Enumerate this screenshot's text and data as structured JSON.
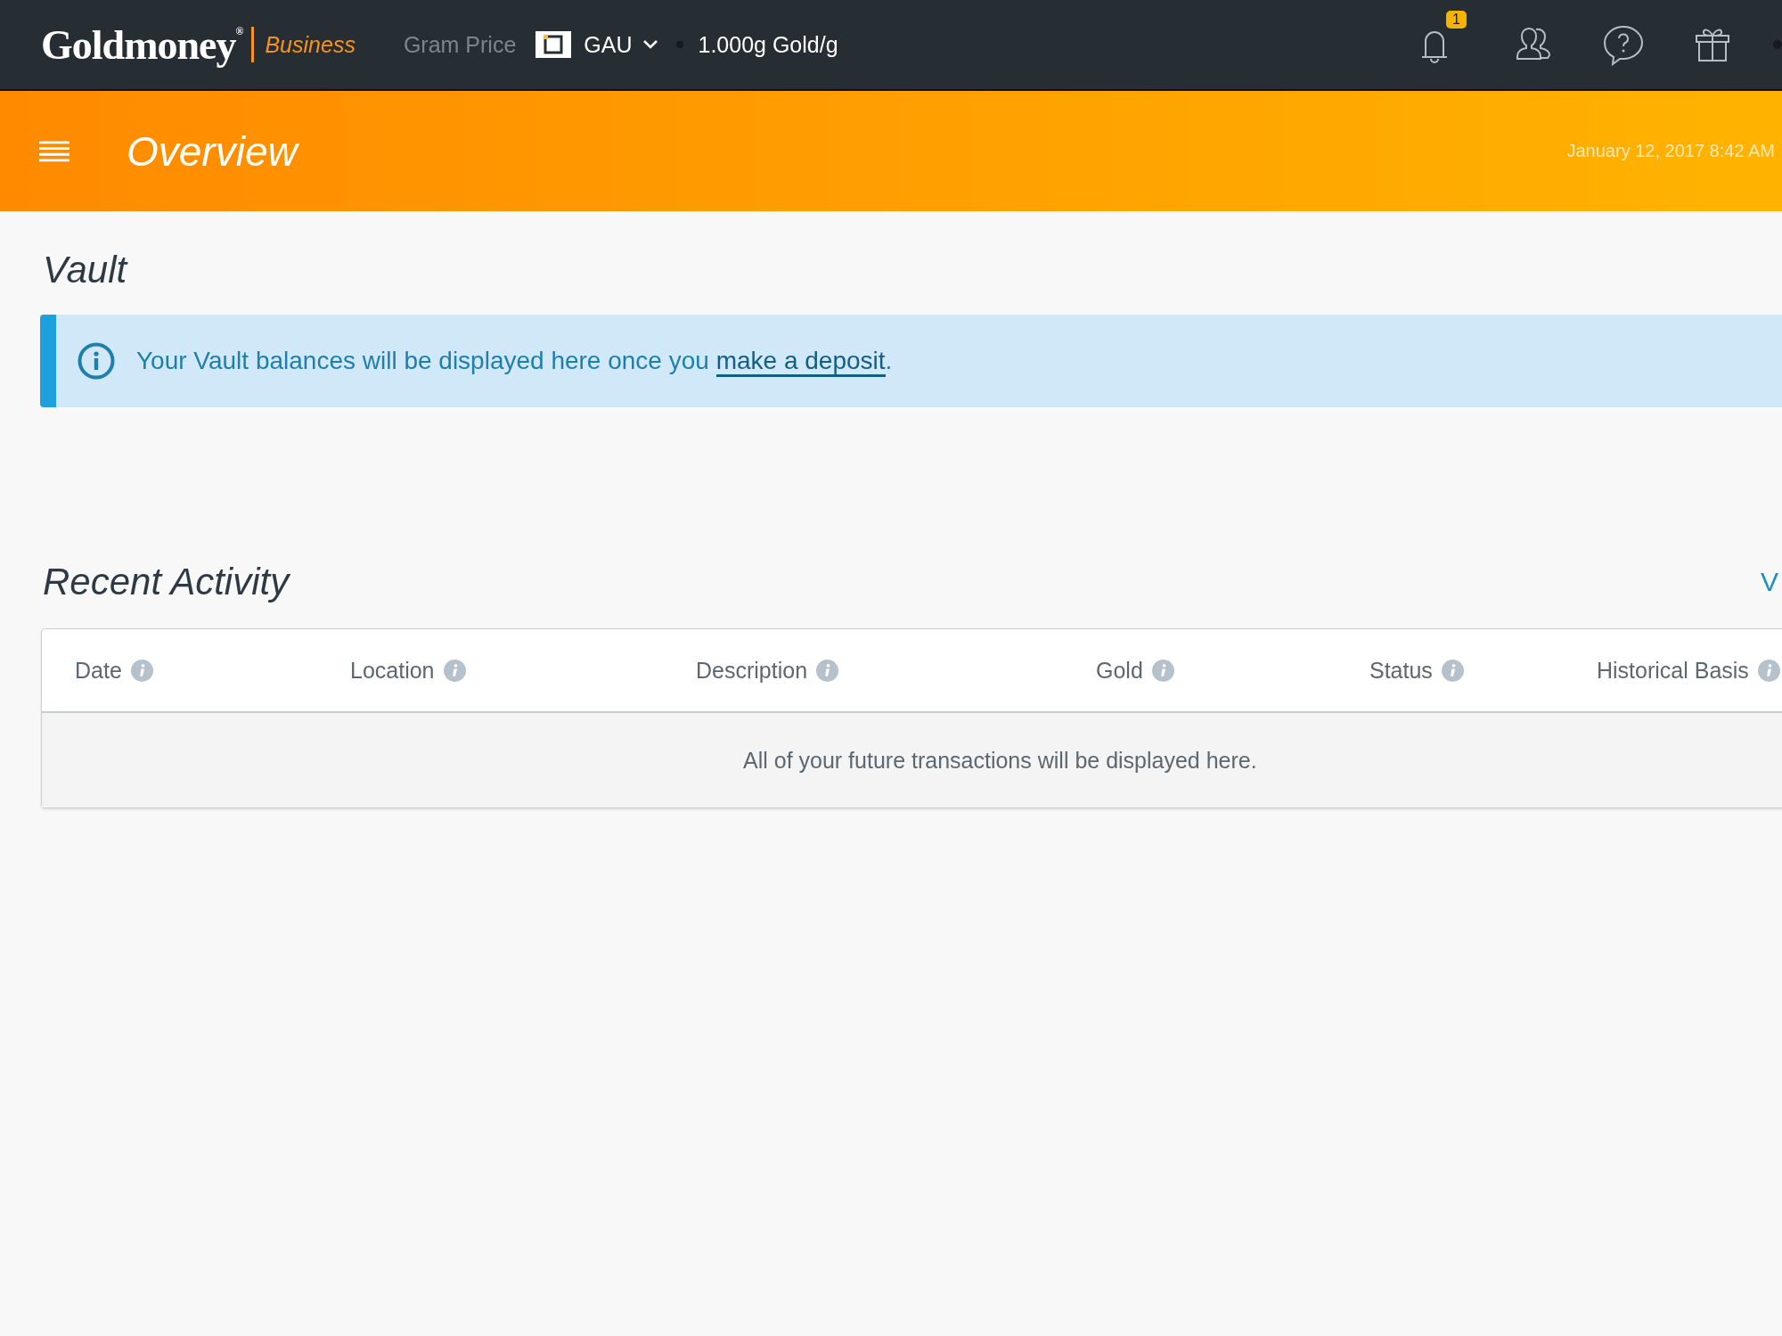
{
  "header": {
    "logo": "Goldmoney$^{®}$",
    "product": "Business",
    "gram_price_label": "Gram Price",
    "currency": "GAU",
    "price": "1.000g Gold/g",
    "notification_count": "1"
  },
  "title_bar": {
    "title": "Overview",
    "datetime": "January 12, 2017 8:42 AM"
  },
  "vault": {
    "title": "Vault",
    "notice": {
      "text": "Your Vault balances will be displayed here once you ",
      "link": "make a deposit",
      "end": "."
    }
  },
  "recent_activity": {
    "title": "Recent Activity",
    "link": "V",
    "table": {
      "columns": [
        {
          "label": "Date"
        },
        {
          "label": "Location"
        },
        {
          "label": "Description"
        },
        {
          "label": "Gold"
        },
        {
          "label": "Status"
        },
        {
          "label": "Historical Basis"
        }
      ],
      "empty_message": "All of your future transactions will be displayed here."
    }
  }
}
